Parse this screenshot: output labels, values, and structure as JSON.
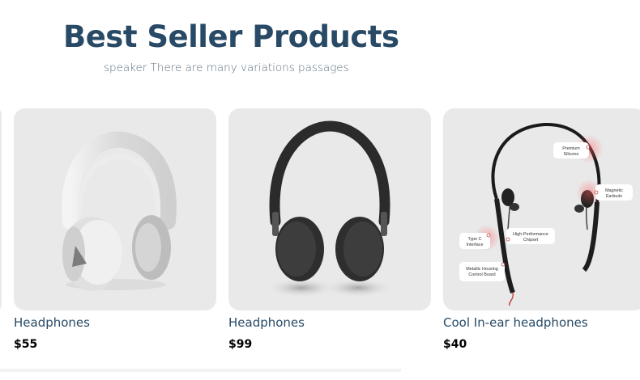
{
  "section": {
    "title": "Best Seller Products",
    "subtitle": "speaker There are many variations passages"
  },
  "products": [
    {
      "name": "Headphones",
      "price": "$55",
      "image": "white-over-ear-headphones"
    },
    {
      "name": "Headphones",
      "price": "$99",
      "image": "black-over-ear-headphones"
    },
    {
      "name": "Cool In-ear headphones",
      "price": "$40",
      "image": "neckband-earphones"
    }
  ],
  "neckband_labels": {
    "premium": [
      "Premium",
      "Silicone"
    ],
    "magnetic": [
      "Magnetic",
      "Earbuds"
    ],
    "chipset": [
      "High-Performance",
      "Chipset"
    ],
    "typec": [
      "Type C",
      "Interface"
    ],
    "housing": [
      "Metallic Housing",
      "Control Board"
    ]
  },
  "colors": {
    "title": "#284a66",
    "card_bg": "#e9e9e9",
    "price": "#000000"
  }
}
